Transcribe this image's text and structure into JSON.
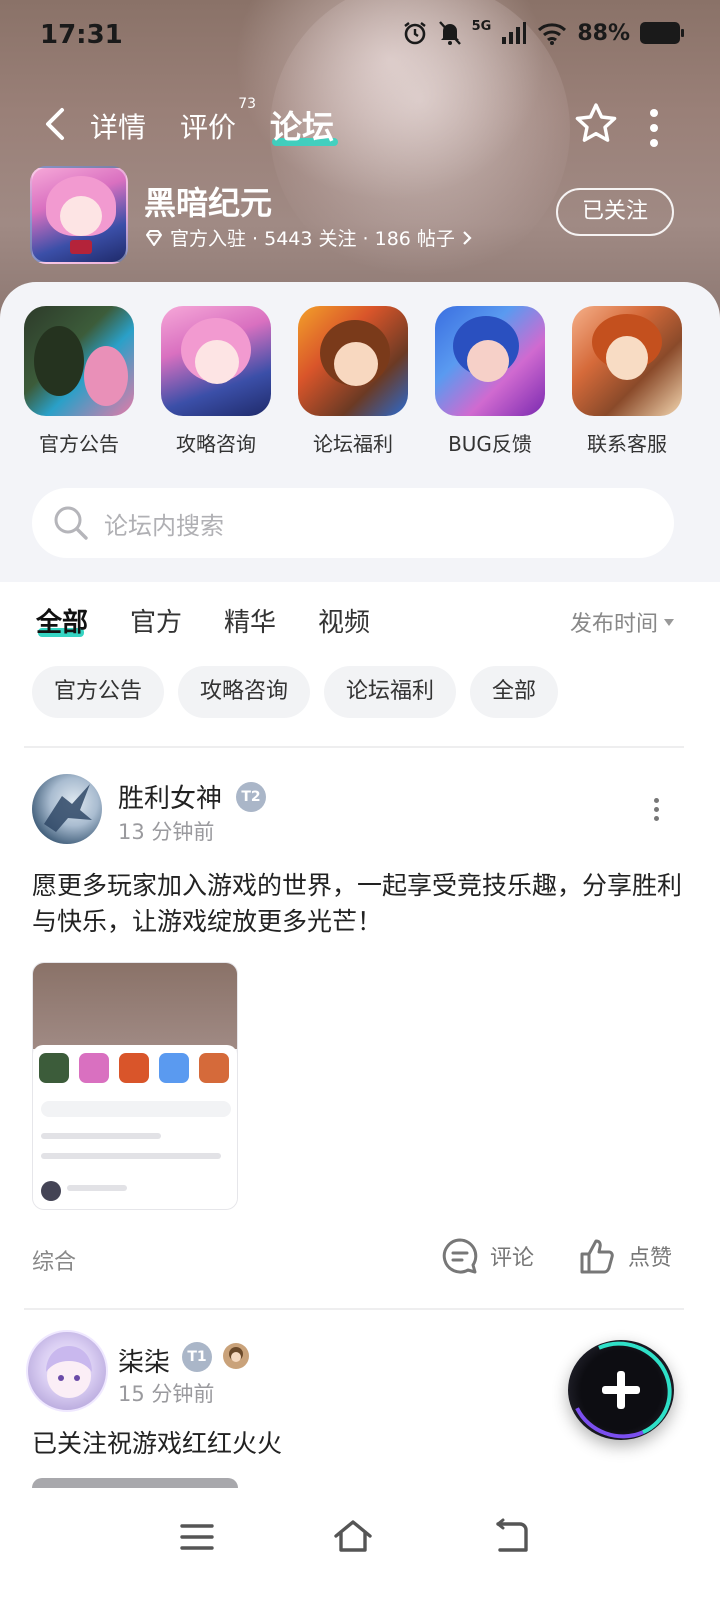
{
  "status_bar": {
    "time": "17:31",
    "network": "5G",
    "battery": "88%"
  },
  "nav": {
    "tabs": [
      {
        "label": "详情"
      },
      {
        "label": "评价",
        "badge": "73"
      },
      {
        "label": "论坛"
      }
    ],
    "active_tab": "论坛"
  },
  "game": {
    "title": "黑暗纪元",
    "meta": "官方入驻 · 5443 关注 · 186 帖子",
    "follow_label": "已关注"
  },
  "shortcuts": [
    {
      "label": "官方公告"
    },
    {
      "label": "攻略咨询"
    },
    {
      "label": "论坛福利"
    },
    {
      "label": "BUG反馈"
    },
    {
      "label": "联系客服"
    }
  ],
  "search": {
    "placeholder": "论坛内搜索"
  },
  "filters": {
    "tabs": [
      "全部",
      "官方",
      "精华",
      "视频"
    ],
    "active": "全部",
    "sort_label": "发布时间"
  },
  "chips": [
    "官方公告",
    "攻略咨询",
    "论坛福利",
    "全部"
  ],
  "posts": [
    {
      "author": "胜利女神",
      "badge": "T2",
      "time": "13 分钟前",
      "text": "愿更多玩家加入游戏的世界，一起享受竞技乐趣，分享胜利与快乐，让游戏绽放更多光芒！",
      "tag": "综合",
      "comment_label": "评论",
      "like_label": "点赞"
    },
    {
      "author": "柒柒",
      "badge": "T1",
      "time": "15 分钟前",
      "text": "已关注祝游戏红红火火"
    }
  ],
  "colors": {
    "accent": "#35d4c2",
    "hero_bg": "#957d76",
    "panel_bg": "#f3f4f8"
  },
  "icons": {
    "back": "chevron-left-icon",
    "favorite": "star-icon",
    "more": "more-vertical-icon",
    "search": "search-icon",
    "comment": "comment-icon",
    "like": "thumbs-up-icon",
    "fab": "plus-icon"
  }
}
